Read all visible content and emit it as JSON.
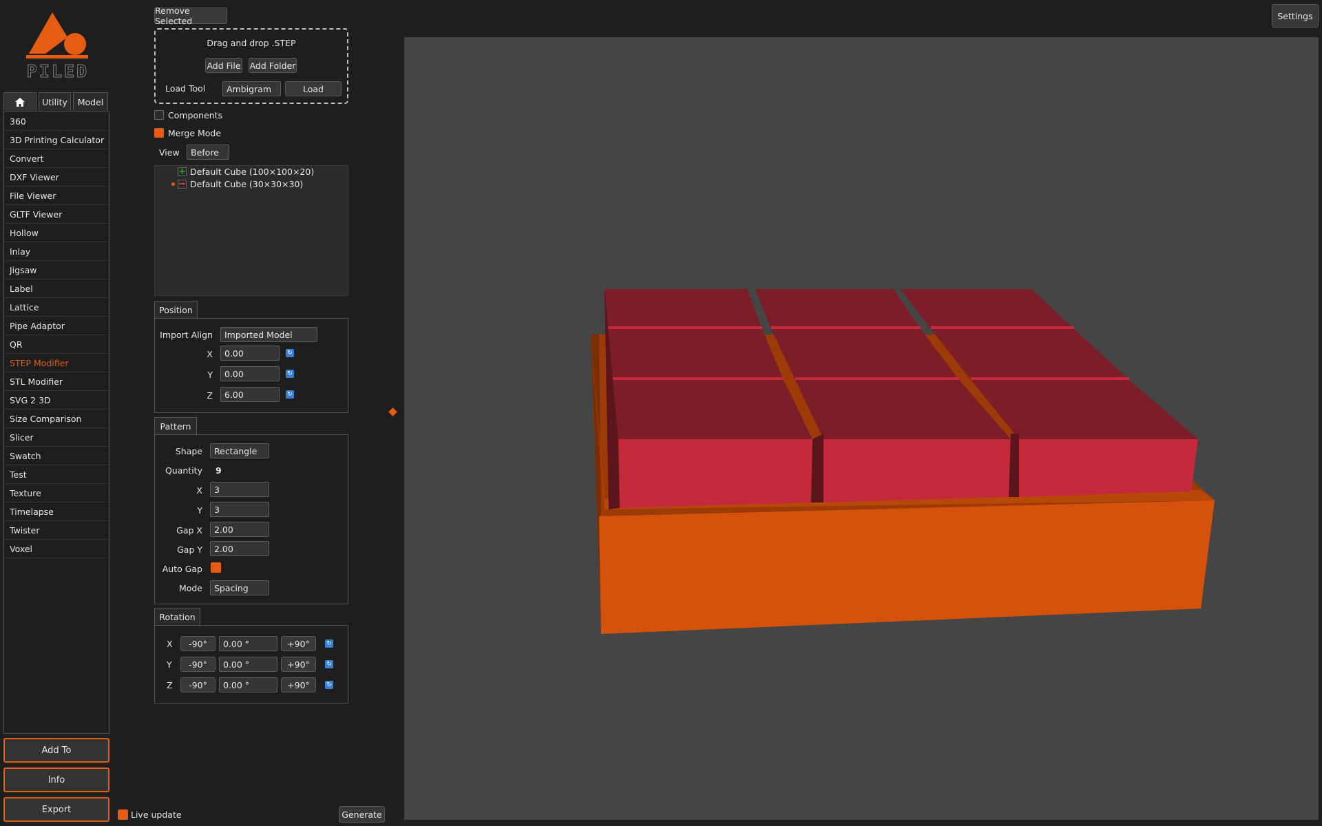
{
  "brand": {
    "logo_text": "PILED",
    "accent": "#e65c12"
  },
  "top": {
    "remove_selected": "Remove Selected",
    "settings": "Settings"
  },
  "tabs": [
    {
      "label": "",
      "icon": "home-icon"
    },
    {
      "label": "Utility"
    },
    {
      "label": "Model"
    }
  ],
  "tools": {
    "items": [
      "360",
      "3D Printing Calculator",
      "Convert",
      "DXF Viewer",
      "File Viewer",
      "GLTF Viewer",
      "Hollow",
      "Inlay",
      "Jigsaw",
      "Label",
      "Lattice",
      "Pipe Adaptor",
      "QR",
      "STEP Modifier",
      "STL Modifier",
      "SVG 2 3D",
      "Size Comparison",
      "Slicer",
      "Swatch",
      "Test",
      "Texture",
      "Timelapse",
      "Twister",
      "Voxel"
    ],
    "active": "STEP Modifier"
  },
  "sidebar_buttons": {
    "add_to": "Add To",
    "info": "Info",
    "export": "Export"
  },
  "dropzone": {
    "title": "Drag and drop .STEP",
    "add_file": "Add File",
    "add_folder": "Add Folder",
    "load_tool_label": "Load Tool",
    "load_tool_value": "Ambigram",
    "load_button": "Load"
  },
  "options": {
    "components_label": "Components",
    "components_checked": false,
    "merge_mode_label": "Merge Mode",
    "merge_mode_checked": true,
    "view_label": "View",
    "view_value": "Before"
  },
  "objects": [
    {
      "name": "Default Cube (100×100×20)",
      "op": "add",
      "icon": "plus-icon"
    },
    {
      "name": "Default Cube (30×30×30)",
      "op": "subtract",
      "icon": "minus-icon",
      "selected": true
    }
  ],
  "position": {
    "title": "Position",
    "import_align_label": "Import Align",
    "import_align_value": "Imported Model",
    "x_label": "X",
    "x_value": "0.00",
    "y_label": "Y",
    "y_value": "0.00",
    "z_label": "Z",
    "z_value": "6.00"
  },
  "pattern": {
    "title": "Pattern",
    "shape_label": "Shape",
    "shape_value": "Rectangle",
    "quantity_label": "Quantity",
    "quantity_value": "9",
    "x_label": "X",
    "x_value": "3",
    "y_label": "Y",
    "y_value": "3",
    "gap_x_label": "Gap X",
    "gap_x_value": "2.00",
    "gap_y_label": "Gap Y",
    "gap_y_value": "2.00",
    "auto_gap_label": "Auto Gap",
    "auto_gap_checked": true,
    "mode_label": "Mode",
    "mode_value": "Spacing"
  },
  "rotation": {
    "title": "Rotation",
    "minus": "-90°",
    "plus": "+90°",
    "x_label": "X",
    "x_value": "0.00 °",
    "y_label": "Y",
    "y_value": "0.00 °",
    "z_label": "Z",
    "z_value": "0.00 °"
  },
  "footer": {
    "live_update_label": "Live update",
    "live_update_checked": true,
    "generate": "Generate"
  },
  "viewport": {
    "background": "#454545",
    "base_color": "#d4520c",
    "cube_front_color": "#c42a3c",
    "cube_top_color": "#7d1d28",
    "grid": [
      3,
      3
    ]
  }
}
